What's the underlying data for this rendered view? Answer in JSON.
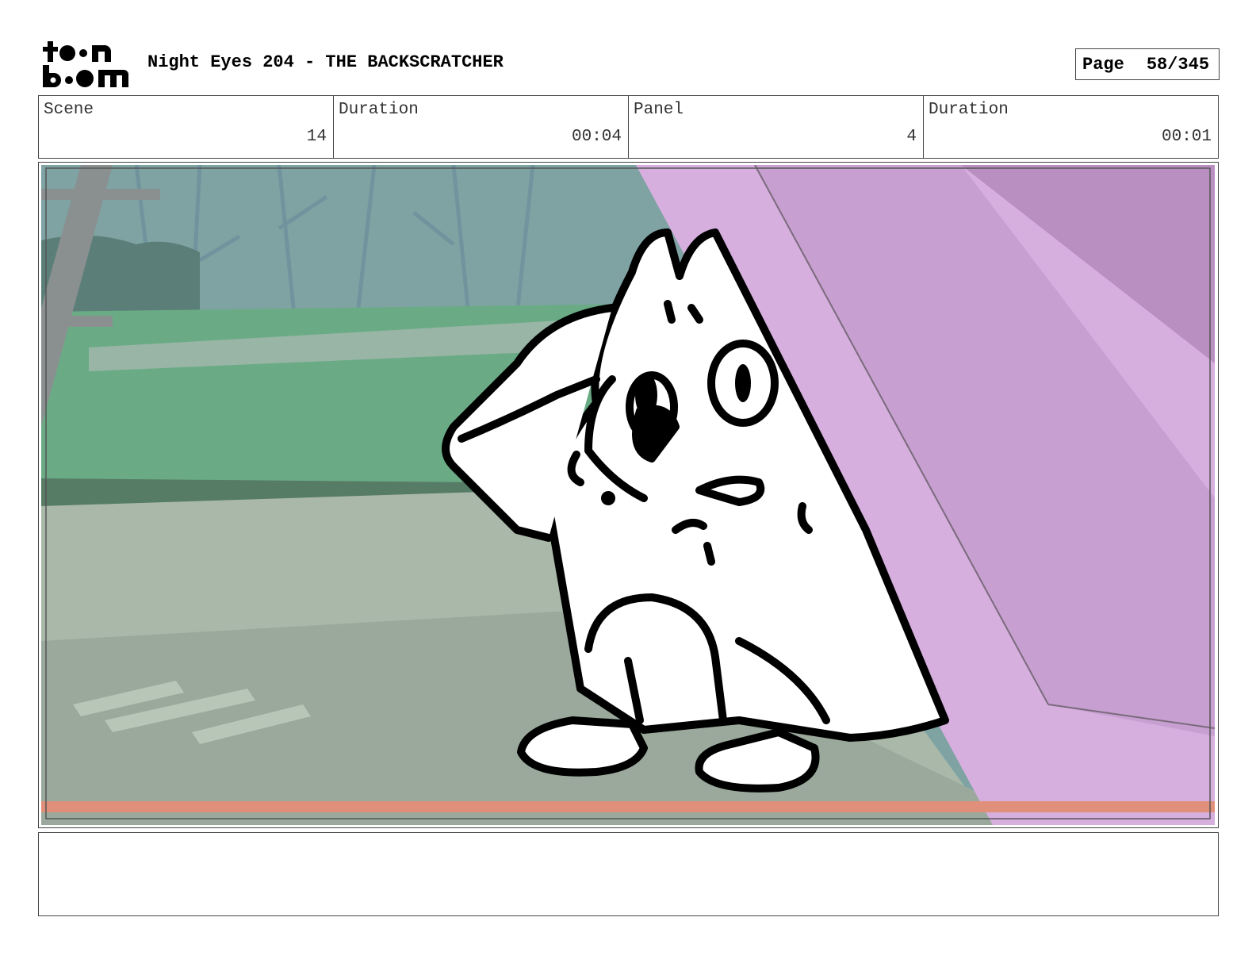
{
  "header": {
    "logo_text": "toon boom",
    "title": "Night Eyes 204 - THE BACKSCRATCHER",
    "page_label": "Page",
    "page_number": "58/345"
  },
  "info": {
    "scene_label": "Scene",
    "scene_value": "14",
    "scene_duration_label": "Duration",
    "scene_duration_value": "00:04",
    "panel_label": "Panel",
    "panel_value": "4",
    "panel_duration_label": "Duration",
    "panel_duration_value": "00:01"
  },
  "notes": {
    "text": ""
  },
  "colors": {
    "sky_teal": "#7fa6a4",
    "grass_green": "#6fae86",
    "ground_gray": "#a8b8a8",
    "pink_wall": "#d7aee0",
    "safe_line": "#e0907a",
    "outline": "#000000"
  }
}
